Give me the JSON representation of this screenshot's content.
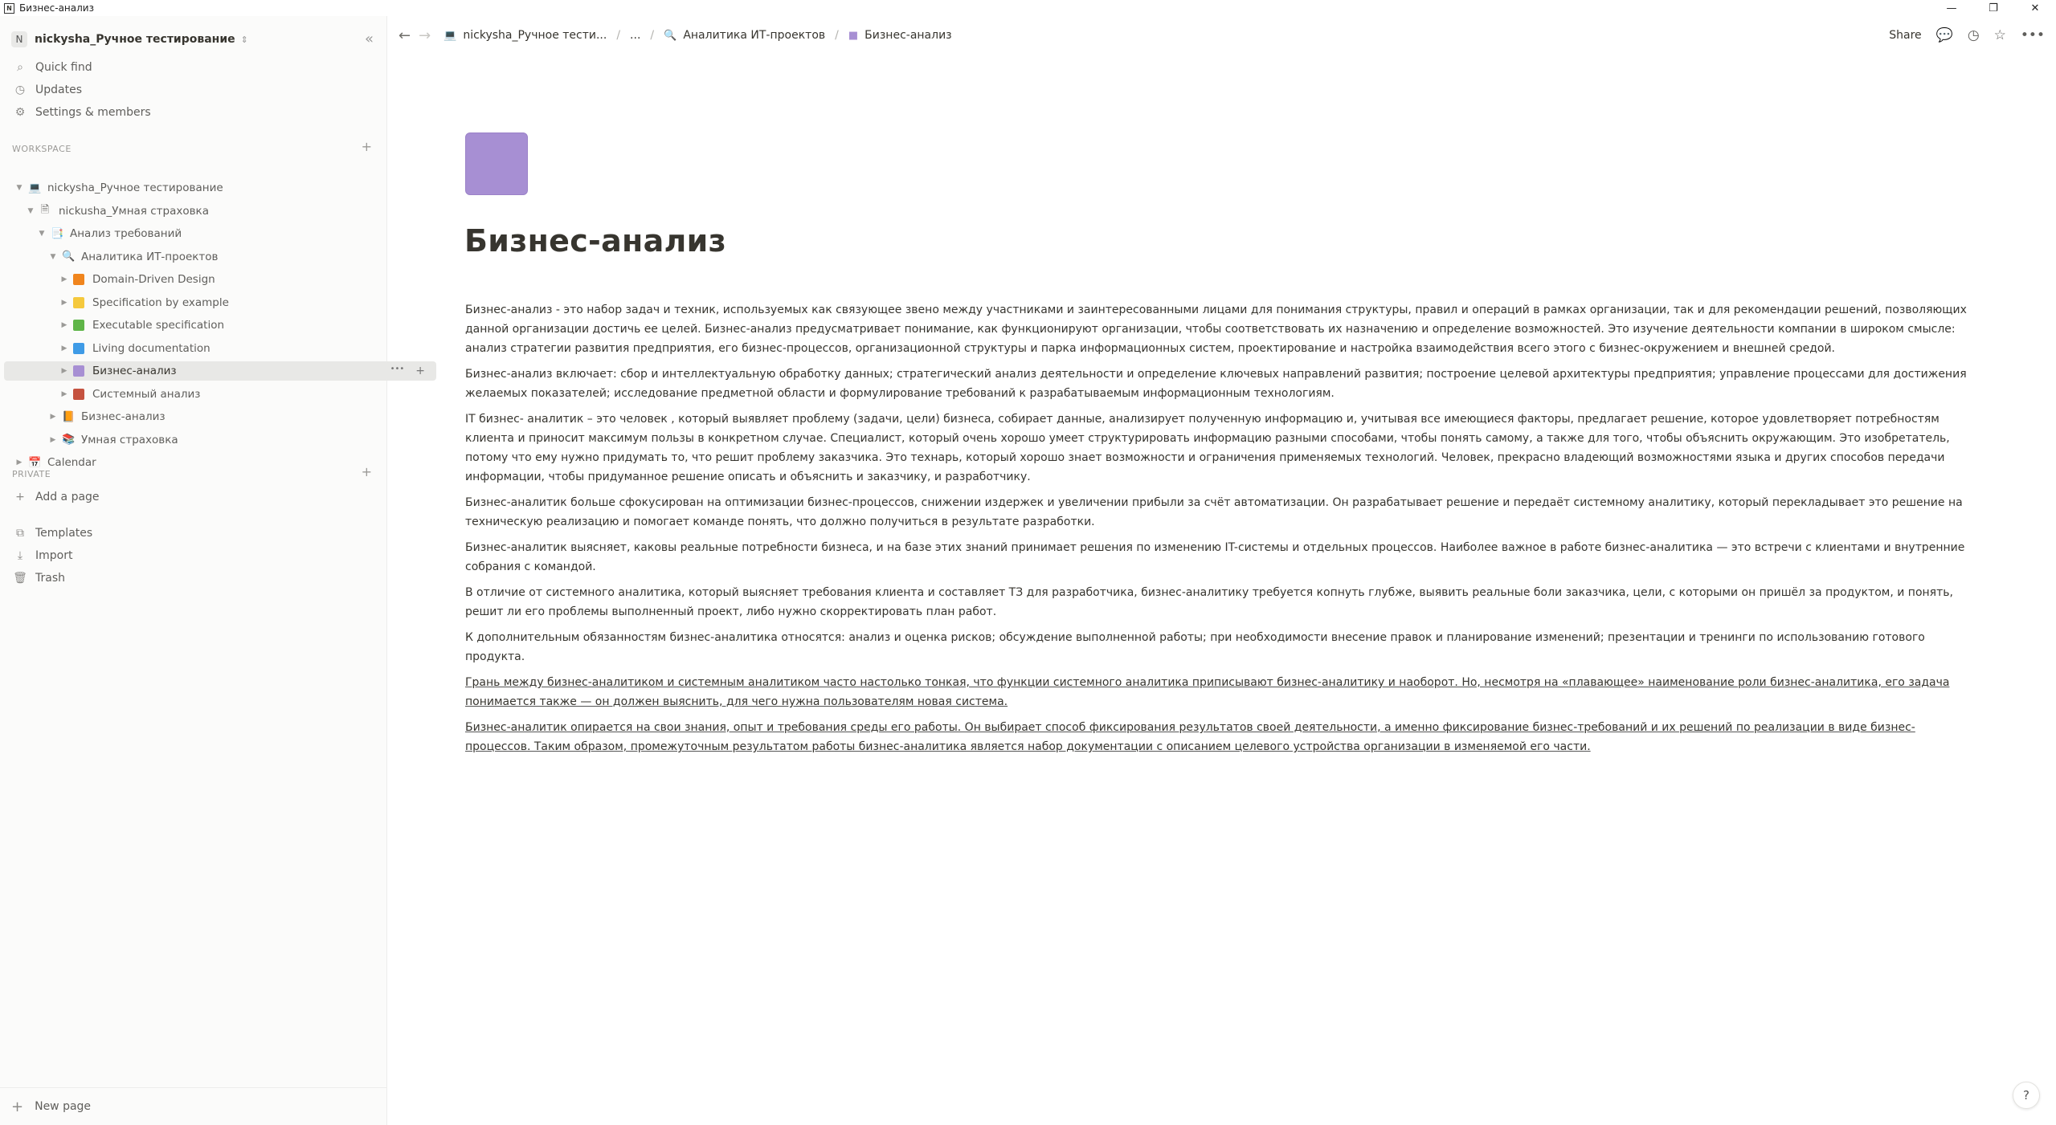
{
  "window": {
    "title": "Бизнес-анализ",
    "app_glyph": "N",
    "controls": [
      "—",
      "❐",
      "✕"
    ]
  },
  "sidebar": {
    "workspace_avatar": "N",
    "workspace_name": "nickysha_Ручное тестирование",
    "collapse_glyph": "«",
    "nav": [
      {
        "label": "Quick find",
        "icon": "search-icon",
        "glyph": "⌕"
      },
      {
        "label": "Updates",
        "icon": "clock-icon",
        "glyph": "◷"
      },
      {
        "label": "Settings & members",
        "icon": "gear-icon",
        "glyph": "⚙"
      }
    ],
    "workspace_label": "WORKSPACE",
    "private_label": "PRIVATE",
    "tree": [
      {
        "label": "nickysha_Ручное тестирование",
        "depth": 0,
        "caret": "▼",
        "icon": "laptop-icon",
        "glyph": "💻",
        "color": ""
      },
      {
        "label": "nickusha_Умная страховка",
        "depth": 1,
        "caret": "▼",
        "icon": "document-icon",
        "glyph": "🗎",
        "color": ""
      },
      {
        "label": "Анализ требований",
        "depth": 2,
        "caret": "▼",
        "icon": "bookmark-icon",
        "glyph": "📑",
        "color": ""
      },
      {
        "label": "Аналитика ИТ-проектов",
        "depth": 3,
        "caret": "▼",
        "icon": "magnifier-icon",
        "glyph": "🔍",
        "color": ""
      },
      {
        "label": "Domain-Driven Design",
        "depth": 4,
        "caret": "▶",
        "icon": "orange-square-icon",
        "glyph": "",
        "color": "#f0851d"
      },
      {
        "label": "Specification by example",
        "depth": 4,
        "caret": "▶",
        "icon": "yellow-square-icon",
        "glyph": "",
        "color": "#f5c93d"
      },
      {
        "label": "Executable specification",
        "depth": 4,
        "caret": "▶",
        "icon": "green-square-icon",
        "glyph": "",
        "color": "#5fb548"
      },
      {
        "label": "Living documentation",
        "depth": 4,
        "caret": "▶",
        "icon": "blue-square-icon",
        "glyph": "",
        "color": "#3f9be6"
      },
      {
        "label": "Бизнес-анализ",
        "depth": 4,
        "caret": "▶",
        "icon": "purple-square-icon",
        "glyph": "",
        "color": "#a78fd3",
        "active": true
      },
      {
        "label": "Системный анализ",
        "depth": 4,
        "caret": "▶",
        "icon": "brown-square-icon",
        "glyph": "",
        "color": "#c5523f"
      },
      {
        "label": "Бизнес-анализ",
        "depth": 3,
        "caret": "▶",
        "icon": "notebook-icon",
        "glyph": "📙",
        "color": ""
      },
      {
        "label": "Умная страховка",
        "depth": 3,
        "caret": "▶",
        "icon": "books-icon",
        "glyph": "📚",
        "color": ""
      },
      {
        "label": "Calendar",
        "depth": 0,
        "caret": "▶",
        "icon": "calendar-icon",
        "glyph": "📅",
        "color": ""
      }
    ],
    "add_page": "Add a page",
    "bottom_nav": [
      {
        "label": "Templates",
        "icon": "templates-icon",
        "glyph": "⧉"
      },
      {
        "label": "Import",
        "icon": "download-icon",
        "glyph": "⤓"
      },
      {
        "label": "Trash",
        "icon": "trash-icon",
        "glyph": "🗑"
      }
    ],
    "new_page": "New page"
  },
  "topbar": {
    "breadcrumbs": [
      {
        "label": "nickysha_Ручное тести...",
        "icon": "laptop-icon",
        "glyph": "💻"
      },
      {
        "label": "...",
        "icon": "",
        "glyph": ""
      },
      {
        "label": "Аналитика ИТ-проектов",
        "icon": "magnifier-icon",
        "glyph": "🔍"
      },
      {
        "label": "Бизнес-анализ",
        "icon": "purple-square-icon",
        "glyph": "■"
      }
    ],
    "share": "Share",
    "action_glyphs": {
      "comments": "💬",
      "history": "◷",
      "favorite": "☆",
      "more": "•••"
    }
  },
  "page": {
    "icon_color": "#a78fd3",
    "title": "Бизнес-анализ",
    "paragraphs": [
      {
        "text": "Бизнес-анализ - это набор задач и техник, используемых как связующее звено между участниками и заинтересованными лицами для понимания структуры, правил и операций в рамках организации, так и для рекомендации решений, позволяющих данной организации достичь ее целей. Бизнес-анализ предусматривает понимание, как функционируют организации, чтобы соответствовать их назначению и определение возможностей. Это изучение деятельности компании в широком смысле: анализ стратегии развития предприятия, его бизнес-процессов, организационной структуры и парка информационных систем, проектирование и настройка взаимодействия всего этого с бизнес-окружением и внешней средой.",
        "underline": false
      },
      {
        "text": "Бизнес-анализ включает: сбор и интеллектуальную обработку данных; стратегический анализ деятельности и определение ключевых направлений развития; построение целевой архитектуры предприятия; управление процессами для достижения желаемых показателей; исследование предметной области и формулирование требований к разрабатываемым информационным технологиям.",
        "underline": false
      },
      {
        "text": "IT  бизнес- аналитик – это человек , который выявляет проблему (задачи, цели) бизнеса, собирает данные, анализирует полученную информацию и, учитывая все имеющиеся факторы, предлагает решение, которое удовлетворяет потребностям клиента и приносит максимум пользы в конкретном случае. Специалист, который очень хорошо умеет структурировать информацию разными способами, чтобы понять самому, а также для того, чтобы объяснить окружающим. Это изобретатель, потому что ему нужно придумать то, что решит проблему заказчика. Это технарь, который хорошо знает возможности и ограничения применяемых технологий. Человек, прекрасно владеющий возможностями языка и других способов передачи информации, чтобы придуманное решение описать и объяснить и заказчику, и разработчику.",
        "underline": false
      },
      {
        "text": "Бизнес-аналитик больше сфокусирован на оптимизации бизнес-процессов, снижении издержек и увеличении прибыли за счёт автоматизации. Он разрабатывает решение и передаёт системному аналитику, который перекладывает это решение на техническую реализацию и помогает команде понять, что должно получиться в результате разработки.",
        "underline": false
      },
      {
        "text": "Бизнес-аналитик выясняет, каковы реальные потребности бизнеса, и на базе этих знаний принимает решения по изменению IT-системы и отдельных процессов. Наиболее важное в работе бизнес-аналитика — это встречи с клиентами и внутренние собрания с командой.",
        "underline": false
      },
      {
        "text": "В отличие от системного аналитика, который выясняет требования клиента и составляет ТЗ для разработчика, бизнес-аналитику требуется копнуть глубже, выявить реальные боли заказчика, цели, с которыми он пришёл за продуктом, и понять, решит ли его проблемы выполненный проект, либо нужно скорректировать план работ.",
        "underline": false
      },
      {
        "text": "К дополнительным обязанностям бизнес-аналитика относятся: анализ и оценка рисков; обсуждение выполненной работы; при необходимости внесение правок и планирование изменений; презентации и тренинги по использованию готового продукта.",
        "underline": false
      },
      {
        "text": "Грань между бизнес-аналитиком и системным аналитиком часто настолько тонкая, что функции системного аналитика приписывают бизнес-аналитику и наоборот. Но, несмотря на «плавающее» наименование роли бизнес-аналитика, его задача понимается также — он должен выяснить, для чего нужна пользователям новая система.",
        "underline": true
      },
      {
        "text": "Бизнес-аналитик опирается на свои знания, опыт и требования среды его работы. Он выбирает способ фиксирования результатов своей деятельности, а именно фиксирование бизнес-требований и их решений по реализации в виде бизнес-процессов. Таким образом, промежуточным результатом работы бизнес-аналитика является набор документации с описанием целевого устройства организации в изменяемой его части.",
        "underline": true
      }
    ]
  },
  "help": "?"
}
